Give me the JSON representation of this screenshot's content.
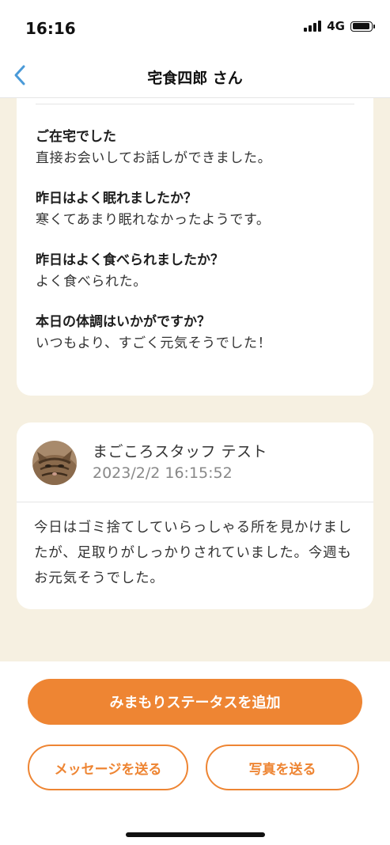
{
  "status_bar": {
    "time": "16:16",
    "network": "4G",
    "signal_icon": "cellular-signal-icon",
    "battery_icon": "battery-icon"
  },
  "nav": {
    "title": "宅食四郎 さん",
    "back_icon": "chevron-left-icon",
    "accent_color": "#4a9ad8"
  },
  "status_card": {
    "items": [
      {
        "label": "ご在宅でした",
        "value": "直接お会いしてお話しができました。"
      },
      {
        "label": "昨日はよく眠れましたか？",
        "value": "寒くてあまり眠れなかったようです。"
      },
      {
        "label": "昨日はよく食べられましたか？",
        "value": "よく食べられた。"
      },
      {
        "label": "本日の体調はいかがですか？",
        "value": "いつもより、すごく元気そうでした！"
      }
    ]
  },
  "message_card": {
    "author": "まごころスタッフ テスト",
    "timestamp": "2023/2/2 16:15:52",
    "body": "今日はゴミ捨てしていらっしゃる所を見かけましたが、足取りがしっかりされていました。今週もお元気そうでした。"
  },
  "actions": {
    "add_status": "みまもりステータスを追加",
    "send_message": "メッセージを送る",
    "send_photo": "写真を送る",
    "primary_color": "#ee8533"
  },
  "colors": {
    "content_background": "#f6f0e1",
    "card_background": "#ffffff"
  }
}
